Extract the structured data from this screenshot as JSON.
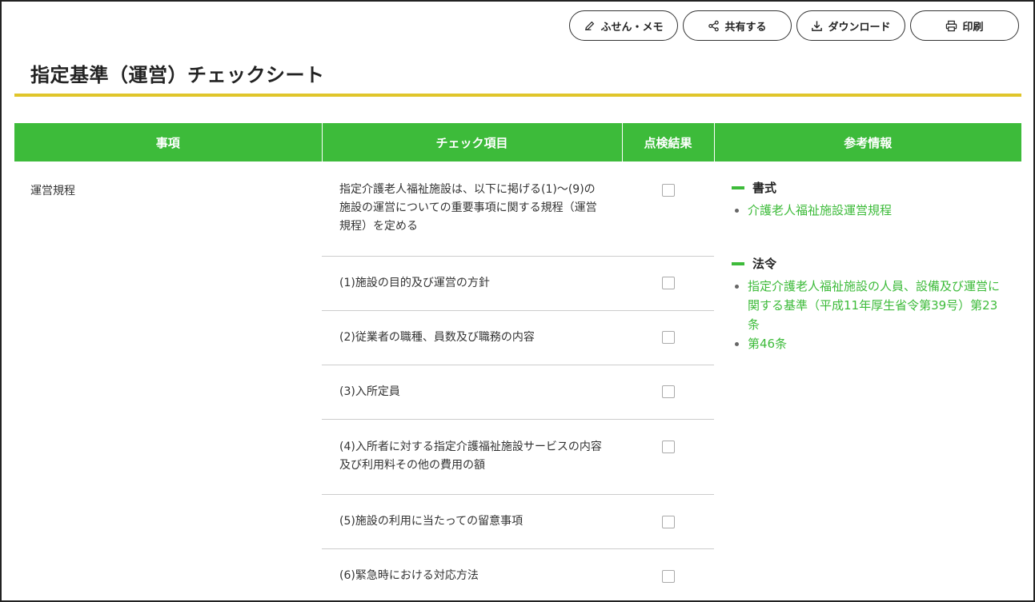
{
  "toolbar": {
    "memo_label": "ふせん・メモ",
    "share_label": "共有する",
    "download_label": "ダウンロード",
    "print_label": "印刷"
  },
  "page": {
    "title": "指定基準（運営）チェックシート"
  },
  "table": {
    "headers": [
      "事項",
      "チェック項目",
      "点検結果",
      "参考情報"
    ],
    "jiko": "運営規程",
    "rows": [
      {
        "text": "指定介護老人福祉施設は、以下に掲げる(1)〜(9)の施設の運営についての重要事項に関する規程（運営規程）を定める",
        "checked": false
      },
      {
        "text": "(1)施設の目的及び運営の方針",
        "checked": false
      },
      {
        "text": "(2)従業者の職種、員数及び職務の内容",
        "checked": false
      },
      {
        "text": "(3)入所定員",
        "checked": false
      },
      {
        "text": "(4)入所者に対する指定介護福祉施設サービスの内容及び利用料その他の費用の額",
        "checked": false
      },
      {
        "text": "(5)施設の利用に当たっての留意事項",
        "checked": false
      },
      {
        "text": "(6)緊急時における対応方法",
        "checked": false
      }
    ]
  },
  "reference": {
    "sections": [
      {
        "heading": "書式",
        "links": [
          "介護老人福祉施設運営規程"
        ]
      },
      {
        "heading": "法令",
        "links": [
          "指定介護老人福祉施設の人員、設備及び運営に関する基準（平成11年厚生省令第39号）第23条",
          "第46条"
        ]
      }
    ]
  },
  "colors": {
    "header_green": "#3dbb3a",
    "title_rule": "#e0c52a",
    "link_green": "#3dbb3a"
  },
  "icons": {
    "memo": "pencil-icon",
    "share": "share-icon",
    "download": "download-icon",
    "print": "printer-icon"
  }
}
